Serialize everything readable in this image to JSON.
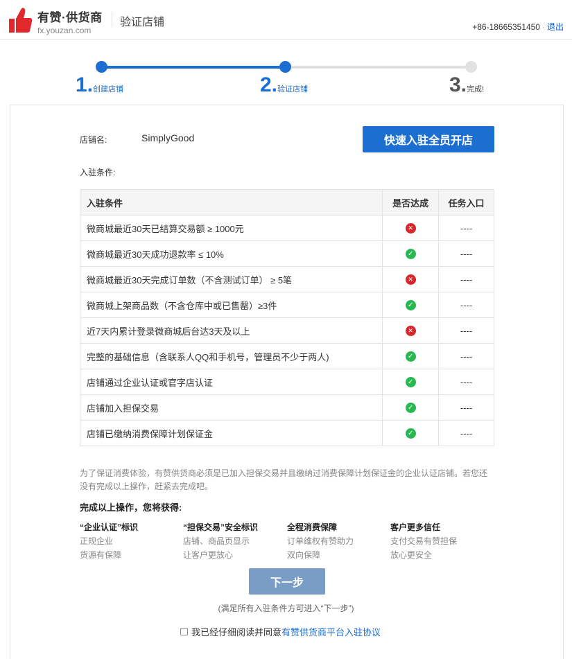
{
  "header": {
    "brand_name": "有赞·供货商",
    "brand_url": "fx.youzan.com",
    "title": "验证店铺",
    "phone": "+86-18665351450",
    "separator": "·",
    "logout": "退出"
  },
  "steps": [
    {
      "num": "1.",
      "label": "创建店铺",
      "state": "done"
    },
    {
      "num": "2.",
      "label": "验证店铺",
      "state": "current"
    },
    {
      "num": "3.",
      "label": "完成!",
      "state": "todo"
    }
  ],
  "shop": {
    "label": "店铺名:",
    "name": "SimplyGood",
    "quick_button": "快速入驻全员开店",
    "conditions_label": "入驻条件:"
  },
  "table": {
    "headers": [
      "入驻条件",
      "是否达成",
      "任务入口"
    ],
    "rows": [
      {
        "condition": "微商城最近30天已结算交易额 ≥ 1000元",
        "met": false,
        "entry": "----"
      },
      {
        "condition": "微商城最近30天成功退款率 ≤ 10%",
        "met": true,
        "entry": "----"
      },
      {
        "condition": "微商城最近30天完成订单数（不含测试订单） ≥ 5笔",
        "met": false,
        "entry": "----"
      },
      {
        "condition": "微商城上架商品数（不含仓库中或已售罄）≥3件",
        "met": true,
        "entry": "----"
      },
      {
        "condition": "近7天内累计登录微商城后台达3天及以上",
        "met": false,
        "entry": "----"
      },
      {
        "condition": "完整的基础信息（含联系人QQ和手机号，管理员不少于两人)",
        "met": true,
        "entry": "----"
      },
      {
        "condition": "店铺通过企业认证或官字店认证",
        "met": true,
        "entry": "----"
      },
      {
        "condition": "店铺加入担保交易",
        "met": true,
        "entry": "----"
      },
      {
        "condition": "店铺已缴纳消费保障计划保证金",
        "met": true,
        "entry": "----"
      }
    ]
  },
  "notice": {
    "line1": "为了保证消费体验，有赞供货商必须是已加入担保交易并且缴纳过消费保障计划保证金的企业认证店铺。若您还",
    "line2": "没有完成以上操作，赶紧去完成吧。"
  },
  "benefits": {
    "title": "完成以上操作，您将获得:",
    "items": [
      {
        "title": "“企业认证”标识",
        "lines": [
          "正规企业",
          "货源有保障"
        ]
      },
      {
        "title": "“担保交易”安全标识",
        "lines": [
          "店铺、商品页显示",
          "让客户更放心"
        ]
      },
      {
        "title": "全程消费保障",
        "lines": [
          "订单维权有赞助力",
          "双向保障"
        ]
      },
      {
        "title": "客户更多信任",
        "lines": [
          "支付交易有赞担保",
          "放心更安全"
        ]
      }
    ]
  },
  "next": {
    "button": "下一步",
    "hint": "(满足所有入驻条件方可进入“下一步”)"
  },
  "agreement": {
    "text": "我已经仔细阅读并同意",
    "link": "有赞供货商平台入驻协议",
    "checked": false
  },
  "colors": {
    "accent": "#1c6ed0",
    "ok": "#27b852",
    "fail": "#d7262c",
    "disabled_button": "#7a9dc6"
  },
  "icons": {
    "logo": "thumbs-up-icon",
    "met": "check-circle-icon",
    "unmet": "x-circle-icon"
  }
}
